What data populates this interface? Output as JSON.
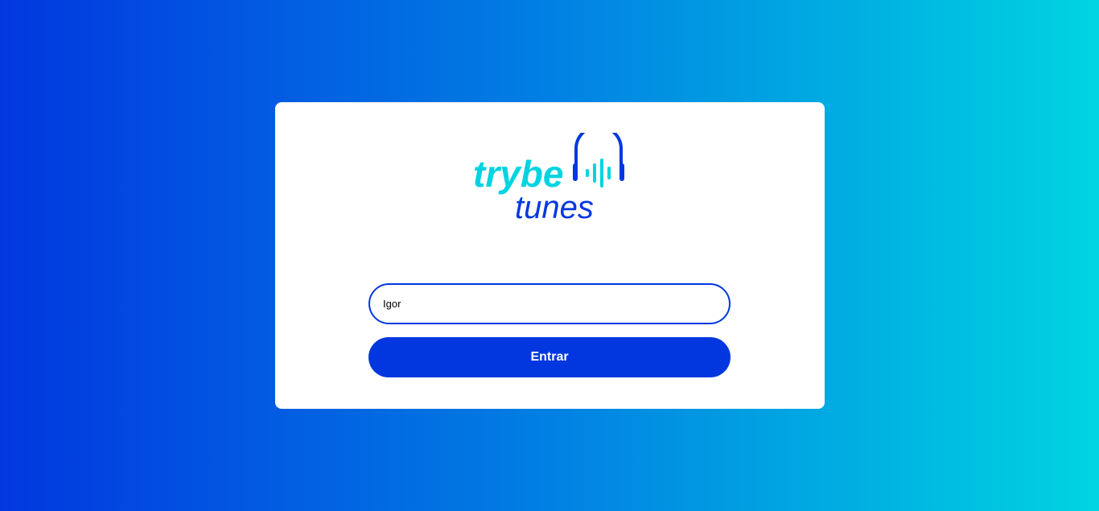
{
  "logo": {
    "line1": "trybe",
    "line2": "tunes",
    "icon": "headphones-soundwave-icon",
    "colors": {
      "primary": "#0237e0",
      "accent": "#00d4e1"
    }
  },
  "login": {
    "name_value": "Igor",
    "button_label": "Entrar"
  },
  "theme": {
    "gradient_start": "#0237e0",
    "gradient_end": "#00d4e1",
    "card_background": "#ffffff"
  }
}
